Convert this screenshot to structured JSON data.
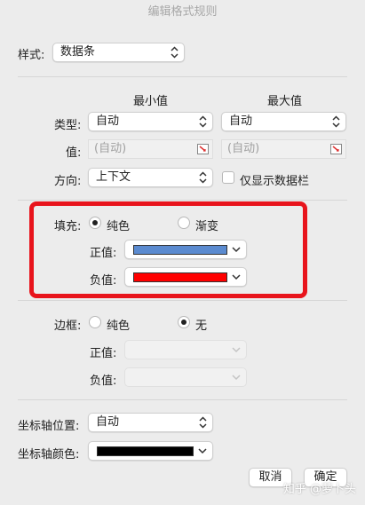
{
  "window": {
    "title": "编辑格式规则"
  },
  "style": {
    "label": "样式:",
    "value": "数据条"
  },
  "columns": {
    "min": "最小值",
    "max": "最大值"
  },
  "type": {
    "label": "类型:",
    "min_value": "自动",
    "max_value": "自动"
  },
  "value": {
    "label": "值:",
    "min_placeholder": "(自动)",
    "max_placeholder": "(自动)"
  },
  "direction": {
    "label": "方向:",
    "value": "上下文",
    "only_show_bar_label": "仅显示数据栏"
  },
  "fill": {
    "label": "填充:",
    "option_solid": "纯色",
    "option_gradient": "渐变",
    "selected": "纯色",
    "positive_label": "正值:",
    "negative_label": "负值:",
    "positive_color": "#5b8bd0",
    "negative_color": "#ff0000"
  },
  "border": {
    "label": "边框:",
    "option_solid": "纯色",
    "option_none": "无",
    "selected": "无",
    "positive_label": "正值:",
    "negative_label": "负值:"
  },
  "axis": {
    "position_label": "坐标轴位置:",
    "position_value": "自动",
    "color_label": "坐标轴颜色:",
    "color": "#000000"
  },
  "buttons": {
    "cancel": "取消",
    "ok": "确定"
  },
  "watermark": "知乎 @萝卜头",
  "colors": {
    "highlight": "#e8141c"
  }
}
